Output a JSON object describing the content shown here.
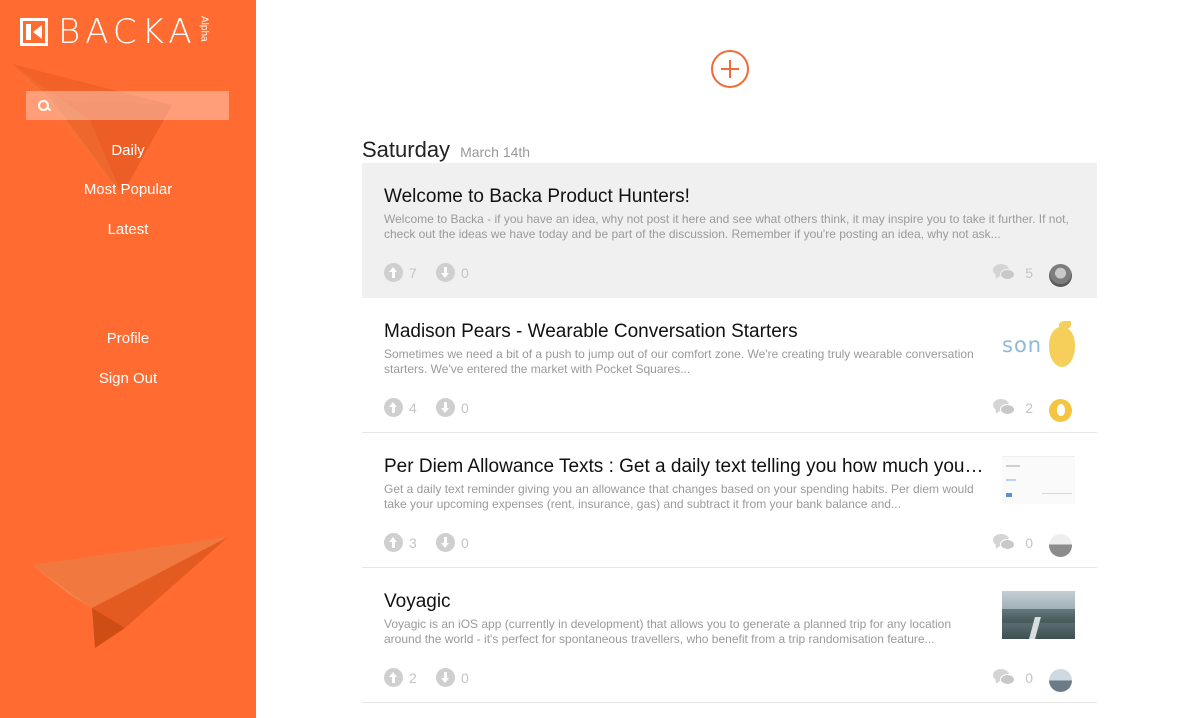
{
  "app": {
    "logo_text": "BACKA",
    "logo_tag": "Alpha"
  },
  "sidebar": {
    "search_placeholder": "",
    "nav": [
      {
        "label": "Daily"
      },
      {
        "label": "Most Popular"
      },
      {
        "label": "Latest"
      },
      {
        "label": "Profile"
      },
      {
        "label": "Sign Out"
      }
    ]
  },
  "theme": {
    "accent": "#ff6b30",
    "highlight_bg": "#f0f0f0"
  },
  "day": {
    "title": "Saturday",
    "date": "March 14th"
  },
  "posts": [
    {
      "title": "Welcome to Backa Product Hunters!",
      "description": "Welcome to Backa - if you have an idea, why not post it here and see what others think, it may inspire you to take it further. If not, check out the ideas we have today and be part of the discussion. Remember if you're posting an idea, why not ask...",
      "upvotes": "7",
      "downvotes": "0",
      "comments": "5",
      "avatar": "user-photo",
      "highlighted": true
    },
    {
      "title": "Madison Pears - Wearable Conversation Starters",
      "description": "Sometimes we need a bit of a push to jump out of our comfort zone. We're creating truly wearable conversation starters. We've entered the market with Pocket Squares...",
      "upvotes": "4",
      "downvotes": "0",
      "comments": "2",
      "avatar": "pear-logo",
      "thumbnail_text": "son"
    },
    {
      "title": "Per Diem Allowance Texts : Get a daily text telling you how much you'r...",
      "description": "Get a daily text reminder giving you an allowance that changes based on your spending habits. Per diem would take your upcoming expenses (rent, insurance, gas) and subtract it from your bank balance and...",
      "upvotes": "3",
      "downvotes": "0",
      "comments": "0",
      "avatar": "user-photo"
    },
    {
      "title": "Voyagic",
      "description": "Voyagic is an iOS app (currently in development) that allows you to generate a planned trip for any location around the world - it's perfect for spontaneous travellers, who benefit from a trip randomisation feature...",
      "upvotes": "2",
      "downvotes": "0",
      "comments": "0",
      "avatar": "user-photo"
    }
  ]
}
